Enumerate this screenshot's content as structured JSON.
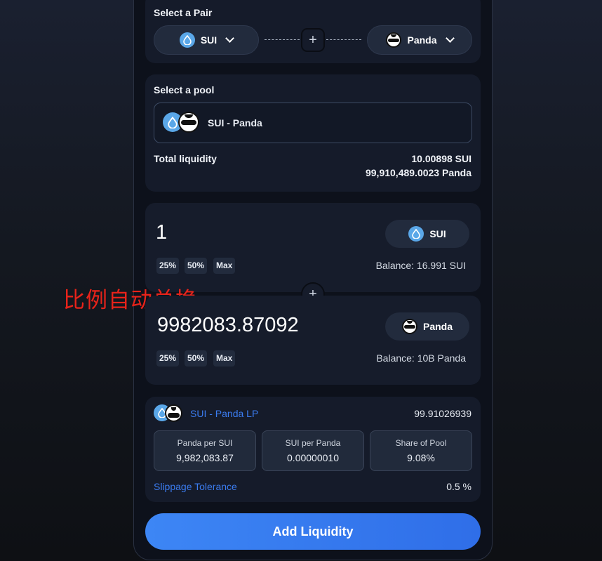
{
  "pair": {
    "label": "Select a Pair",
    "token_a": "SUI",
    "token_b": "Panda"
  },
  "pool": {
    "label": "Select a pool",
    "selected": "SUI - Panda",
    "total_liquidity_label": "Total liquidity",
    "liquidity_a": "10.00898 SUI",
    "liquidity_b": "99,910,489.0023 Panda"
  },
  "input_a": {
    "amount": "1",
    "token": "SUI",
    "balance": "Balance: 16.991 SUI",
    "pct_buttons": [
      "25%",
      "50%",
      "Max"
    ]
  },
  "input_b": {
    "amount": "9982083.87092",
    "token": "Panda",
    "balance": "Balance: 10B Panda",
    "pct_buttons": [
      "25%",
      "50%",
      "Max"
    ]
  },
  "annotation": "比例自动兑换",
  "lp": {
    "name": "SUI - Panda LP",
    "amount": "99.91026939",
    "stats": [
      {
        "title": "Panda per SUI",
        "value": "9,982,083.87"
      },
      {
        "title": "SUI per Panda",
        "value": "0.00000010"
      },
      {
        "title": "Share of Pool",
        "value": "9.08%"
      }
    ],
    "slippage_label": "Slippage Tolerance",
    "slippage_value": "0.5 %"
  },
  "submit_label": "Add Liquidity",
  "colors": {
    "accent": "#3b7cf0",
    "annotation": "#e8231a",
    "sui": "#5aa7e8"
  },
  "icons": [
    "sui-icon",
    "panda-icon",
    "chevron-down-icon",
    "plus-icon"
  ]
}
